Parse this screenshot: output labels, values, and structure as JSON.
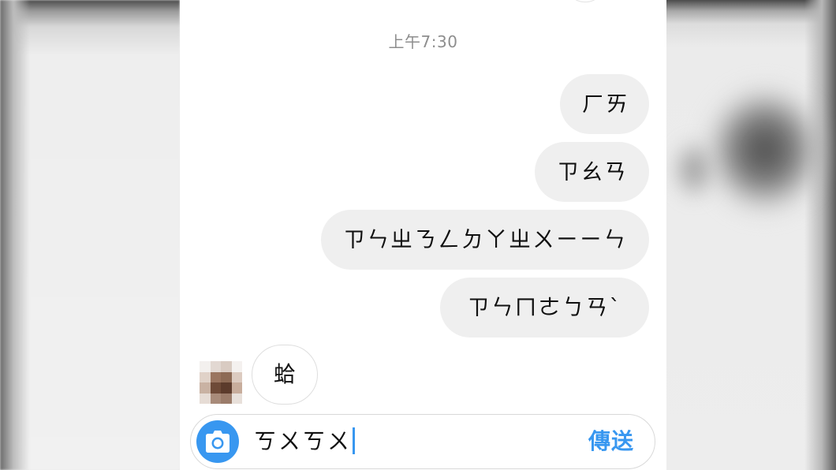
{
  "conversation": {
    "timestamp": "上午7:30",
    "sent_messages": [
      {
        "text": "ㄏㄞ"
      },
      {
        "text": "ㄗㄠㄢ"
      },
      {
        "text": "ㄗㄣㄓㄋㄥㄉㄚㄓㄨㄧㄧㄣ"
      },
      {
        "text": "ㄗㄣㄇㄜㄅㄢˋ"
      }
    ],
    "received_messages": [
      {
        "text": "蛤",
        "sender_avatar": "blurred-avatar"
      }
    ]
  },
  "composer": {
    "camera_icon": "camera-icon",
    "input_value": "ㄎㄨㄎㄨ",
    "send_label": "傳送"
  },
  "colors": {
    "accent": "#3897f0",
    "bubble_bg": "#efefef",
    "timestamp": "#8e8e8e"
  }
}
